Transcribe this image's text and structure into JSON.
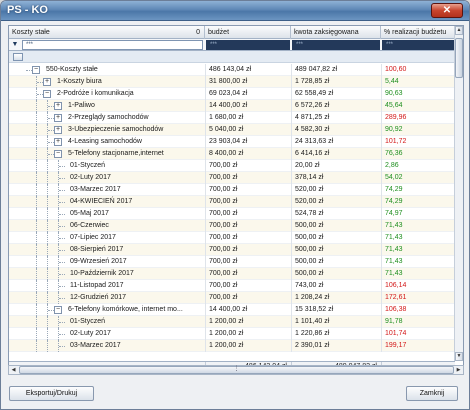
{
  "window": {
    "title": "PS - KO",
    "close_glyph": "✕"
  },
  "header": {
    "col1": "Koszty stałe",
    "col1_count": "0",
    "col2": "budżet",
    "col3": "kwota zaksięgowana",
    "col4": "% realizacji budżetu"
  },
  "filter": {
    "col1": "***",
    "col2": "***",
    "col3": "***",
    "col4": "***"
  },
  "rows": [
    {
      "indent": 0,
      "expander": "minus",
      "label": "550-Koszty stałe",
      "budget": "486 143,04 zł",
      "booked": "489 047,82 zł",
      "pct": "100,60",
      "pct_color": "red"
    },
    {
      "indent": 1,
      "expander": "plus",
      "label": "1-Koszty biura",
      "budget": "31 800,00 zł",
      "booked": "1 728,85 zł",
      "pct": "5,44",
      "pct_color": "green"
    },
    {
      "indent": 1,
      "expander": "minus",
      "label": "2-Podróże i komunikacja",
      "budget": "69 023,04 zł",
      "booked": "62 558,49 zł",
      "pct": "90,63",
      "pct_color": "green"
    },
    {
      "indent": 2,
      "expander": "plus",
      "label": "1-Paliwo",
      "budget": "14 400,00 zł",
      "booked": "6 572,26 zł",
      "pct": "45,64",
      "pct_color": "green"
    },
    {
      "indent": 2,
      "expander": "plus",
      "label": "2-Przeglądy samochodów",
      "budget": "1 680,00 zł",
      "booked": "4 871,25 zł",
      "pct": "289,96",
      "pct_color": "red"
    },
    {
      "indent": 2,
      "expander": "plus",
      "label": "3-Ubezpieczenie samochodów",
      "budget": "5 040,00 zł",
      "booked": "4 582,30 zł",
      "pct": "90,92",
      "pct_color": "green"
    },
    {
      "indent": 2,
      "expander": "plus",
      "label": "4-Leasing samochodów",
      "budget": "23 903,04 zł",
      "booked": "24 313,63 zł",
      "pct": "101,72",
      "pct_color": "red"
    },
    {
      "indent": 2,
      "expander": "minus",
      "label": "5-Telefony stacjonarne,internet",
      "budget": "8 400,00 zł",
      "booked": "6 414,16 zł",
      "pct": "76,36",
      "pct_color": "green"
    },
    {
      "indent": 3,
      "expander": "none",
      "label": "01-Styczeń",
      "budget": "700,00 zł",
      "booked": "20,00 zł",
      "pct": "2,86",
      "pct_color": "green"
    },
    {
      "indent": 3,
      "expander": "none",
      "label": "02-Luty 2017",
      "budget": "700,00 zł",
      "booked": "378,14 zł",
      "pct": "54,02",
      "pct_color": "green"
    },
    {
      "indent": 3,
      "expander": "none",
      "label": "03-Marzec 2017",
      "budget": "700,00 zł",
      "booked": "520,00 zł",
      "pct": "74,29",
      "pct_color": "green"
    },
    {
      "indent": 3,
      "expander": "none",
      "label": "04-KWIECIEŃ 2017",
      "budget": "700,00 zł",
      "booked": "520,00 zł",
      "pct": "74,29",
      "pct_color": "green"
    },
    {
      "indent": 3,
      "expander": "none",
      "label": "05-Maj 2017",
      "budget": "700,00 zł",
      "booked": "524,78 zł",
      "pct": "74,97",
      "pct_color": "green"
    },
    {
      "indent": 3,
      "expander": "none",
      "label": "06-Czerwiec",
      "budget": "700,00 zł",
      "booked": "500,00 zł",
      "pct": "71,43",
      "pct_color": "green"
    },
    {
      "indent": 3,
      "expander": "none",
      "label": "07-Lipiec 2017",
      "budget": "700,00 zł",
      "booked": "500,00 zł",
      "pct": "71,43",
      "pct_color": "green"
    },
    {
      "indent": 3,
      "expander": "none",
      "label": "08-Sierpień 2017",
      "budget": "700,00 zł",
      "booked": "500,00 zł",
      "pct": "71,43",
      "pct_color": "green"
    },
    {
      "indent": 3,
      "expander": "none",
      "label": "09-Wrzesień 2017",
      "budget": "700,00 zł",
      "booked": "500,00 zł",
      "pct": "71,43",
      "pct_color": "green"
    },
    {
      "indent": 3,
      "expander": "none",
      "label": "10-Październik 2017",
      "budget": "700,00 zł",
      "booked": "500,00 zł",
      "pct": "71,43",
      "pct_color": "green"
    },
    {
      "indent": 3,
      "expander": "none",
      "label": "11-Listopad 2017",
      "budget": "700,00 zł",
      "booked": "743,00 zł",
      "pct": "106,14",
      "pct_color": "red"
    },
    {
      "indent": 3,
      "expander": "none",
      "label": "12-Grudzień 2017",
      "budget": "700,00 zł",
      "booked": "1 208,24 zł",
      "pct": "172,61",
      "pct_color": "red"
    },
    {
      "indent": 2,
      "expander": "minus",
      "label": "6-Telefony komórkowe, internet mo...",
      "budget": "14 400,00 zł",
      "booked": "15 318,52 zł",
      "pct": "106,38",
      "pct_color": "red"
    },
    {
      "indent": 3,
      "expander": "none",
      "label": "01-Styczeń",
      "budget": "1 200,00 zł",
      "booked": "1 101,40 zł",
      "pct": "91,78",
      "pct_color": "green"
    },
    {
      "indent": 3,
      "expander": "none",
      "label": "02-Luty 2017",
      "budget": "1 200,00 zł",
      "booked": "1 220,86 zł",
      "pct": "101,74",
      "pct_color": "red"
    },
    {
      "indent": 3,
      "expander": "none",
      "label": "03-Marzec 2017",
      "budget": "1 200,00 zł",
      "booked": "2 390,01 zł",
      "pct": "199,17",
      "pct_color": "red"
    }
  ],
  "footer": {
    "budget_total": "486 143,04 zł",
    "booked_total": "489 047,82 zł"
  },
  "buttons": {
    "export": "Eksportuj/Drukuj",
    "close": "Zamknij"
  },
  "colors": {
    "green": "#1f8f1f",
    "red": "#d31818",
    "title_bar": "#5f88b6"
  }
}
